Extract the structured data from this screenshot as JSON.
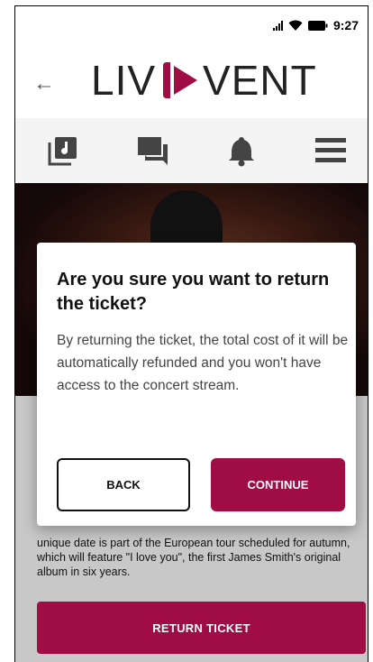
{
  "status_bar": {
    "time": "9:27",
    "signal_icon": "signal-icon",
    "wifi_icon": "wifi-icon",
    "battery_icon": "battery-icon"
  },
  "header": {
    "back_arrow": "←",
    "logo_left": "LIV",
    "logo_right": "VENT",
    "brand_color": "#a00d45"
  },
  "nav": {
    "items": [
      {
        "icon": "music-library-icon"
      },
      {
        "icon": "chat-icon"
      },
      {
        "icon": "bell-icon"
      },
      {
        "icon": "menu-icon"
      }
    ]
  },
  "content": {
    "description": "unique date is part of the European tour scheduled for autumn, which will feature \"I love you\", the first James Smith's original album in six years.",
    "return_button": "RETURN TICKET"
  },
  "modal": {
    "title": "Are you sure you want to return the ticket?",
    "body": "By returning the ticket, the total cost of it will be automatically refunded and you won't have access to the concert stream.",
    "back_label": "BACK",
    "continue_label": "CONTINUE"
  }
}
